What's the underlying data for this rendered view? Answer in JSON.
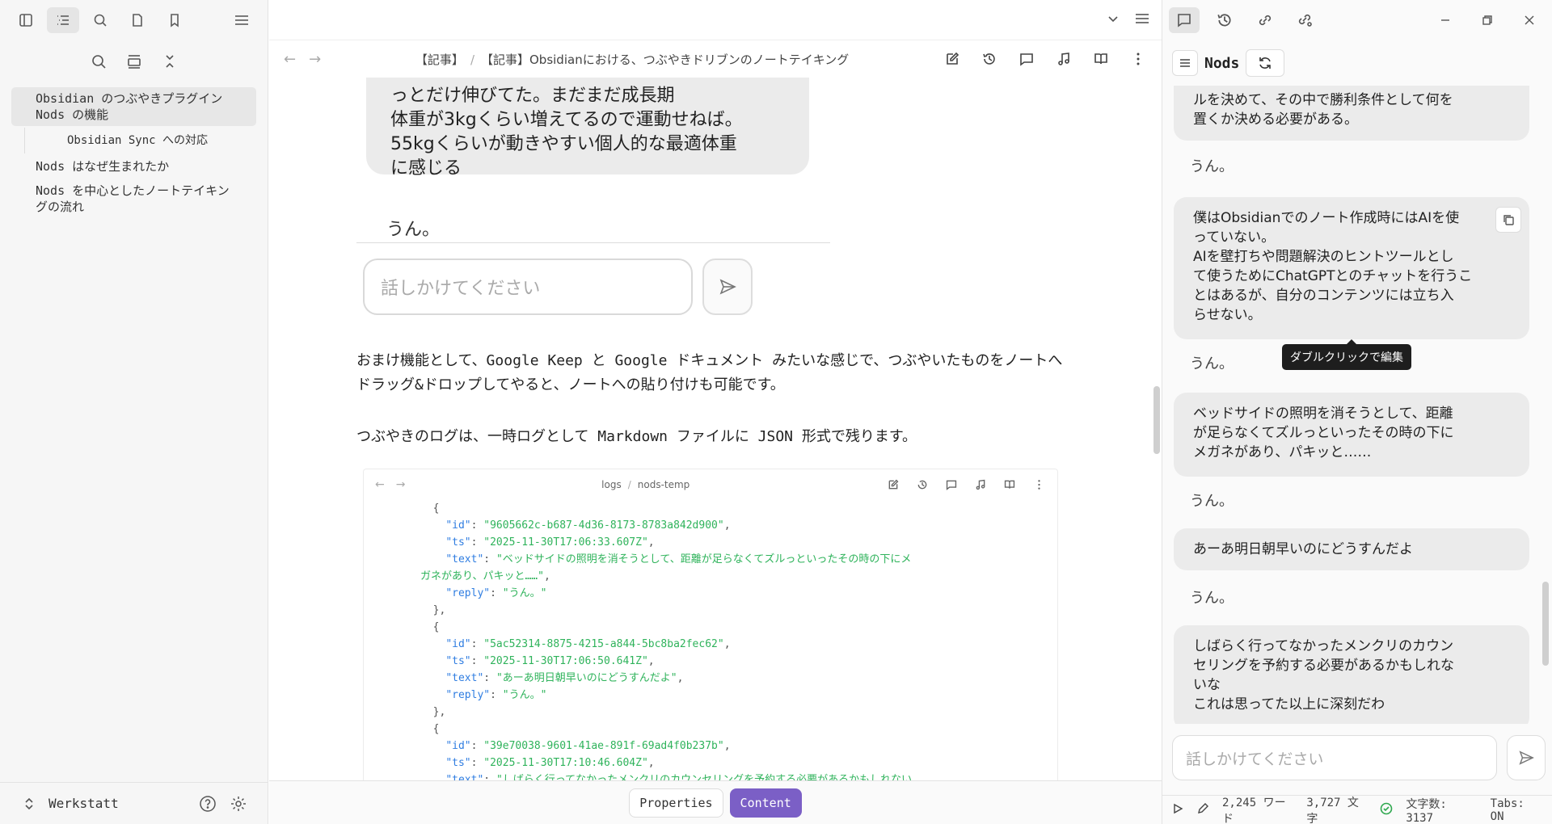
{
  "left_sidebar": {
    "outline": [
      {
        "label": "Obsidian のつぶやきプラグイン Nods の機能",
        "active": true
      },
      {
        "label": "Obsidian Sync への対応"
      },
      {
        "label": "Nods はなぜ生まれたか"
      },
      {
        "label": "Nods を中心としたノートテイキングの流れ"
      }
    ],
    "vault_name": "Werkstatt"
  },
  "center": {
    "breadcrumb": {
      "folder": "【記事】",
      "file": "【記事】Obsidianにおける、つぶやきドリブンのノートテイキング"
    },
    "bubble_lines": [
      "っとだけ伸びてた。まだまだ成長期",
      "体重が3kgくらい増えてるので運動せねば。",
      "55kgくらいが動きやすい個人的な最適体重",
      "に感じる"
    ],
    "bubble_reply": "うん。",
    "input_placeholder": "話しかけてください",
    "paragraph1": "おまけ機能として、Google Keep と Google ドキュメント みたいな感じで、つぶやいたものをノートへドラッグ&ドロップしてやると、ノートへの貼り付けも可能です。",
    "paragraph2": "つぶやきのログは、一時ログとして Markdown ファイルに JSON 形式で残ります。",
    "embed": {
      "breadcrumb_folder": "logs",
      "breadcrumb_file": "nods-temp",
      "entries": [
        {
          "id": "\"9605662c-b687-4d36-8173-8783a842d900\"",
          "ts": "\"2025-11-30T17:06:33.607Z\"",
          "text1": "\"ベッドサイドの照明を消そうとして、距離が足らなくてズルっといったその時の下にメ",
          "text2": "ガネがあり、パキッと……\"",
          "reply": "\"うん。\""
        },
        {
          "id": "\"5ac52314-8875-4215-a844-5bc8ba2fec62\"",
          "ts": "\"2025-11-30T17:06:50.641Z\"",
          "text1": "\"あーあ明日朝早いのにどうすんだよ\"",
          "reply": "\"うん。\""
        },
        {
          "id": "\"39e70038-9601-41ae-891f-69ad4f0b237b\"",
          "ts": "\"2025-11-30T17:10:46.604Z\"",
          "text1": "\"しばらく行ってなかったメンクリのカウンセリングを予約する必要があるかもしれない"
        }
      ]
    },
    "bottom_tabs": {
      "properties": "Properties",
      "content": "Content"
    }
  },
  "right": {
    "title": "Nods",
    "messages": [
      {
        "lines": [
          "ルを決めて、その中で勝利条件として何を",
          "置くか決める必要がある。"
        ],
        "reply": "うん。"
      },
      {
        "lines": [
          "僕はObsidianでのノート作成時にはAIを使",
          "っていない。",
          "AIを壁打ちや問題解決のヒントツールとし",
          "て使うためにChatGPTとのチャットを行うこ",
          "とはあるが、自分のコンテンツには立ち入",
          "らせない。"
        ],
        "reply": "うん。"
      },
      {
        "lines": [
          "ベッドサイドの照明を消そうとして、距離",
          "が足らなくてズルっといったその時の下に",
          "メガネがあり、パキッと……"
        ],
        "reply": "うん。"
      },
      {
        "lines": [
          "あーあ明日朝早いのにどうすんだよ"
        ],
        "reply": "うん。"
      },
      {
        "lines": [
          "しばらく行ってなかったメンクリのカウン",
          "セリングを予約する必要があるかもしれな",
          "いな",
          "これは思ってた以上に深刻だわ"
        ]
      }
    ],
    "tooltip": "ダブルクリックで編集",
    "input_placeholder": "話しかけてください",
    "status": {
      "words": "2,245 ワード",
      "chars": "3,727 文字",
      "char_count": "文字数: 3137",
      "tabs": "Tabs: ON"
    }
  }
}
